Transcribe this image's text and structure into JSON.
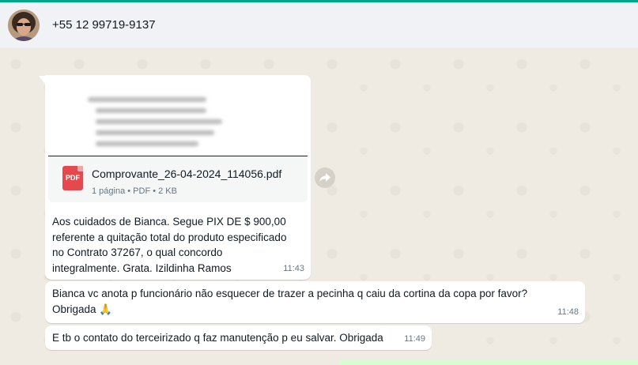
{
  "header": {
    "contact": "+55 12 99719-9137"
  },
  "messages": [
    {
      "document": {
        "filename": "Comprovante_26-04-2024_114056.pdf",
        "meta": "1 página • PDF • 2 KB",
        "icon_text": "PDF"
      },
      "caption_lines": [
        "Aos cuidados de Bianca. Segue PIX DE $ 900,00",
        "referente a quitação total do produto especificado",
        "no Contrato 37267, o qual concordo",
        "integralmente. Grata. Izildinha Ramos"
      ],
      "time": "11:43"
    },
    {
      "lines": [
        "Bianca vc anota p funcionário não esquecer de trazer a pecinha q caiu da cortina da copa por favor?",
        "Obrigada 🙏"
      ],
      "time": "11:48"
    },
    {
      "text": "E tb o contato do terceirizado q faz manutenção p eu salvar. Obrigada",
      "time": "11:49"
    }
  ],
  "icons": {
    "avatar": "avatar",
    "document": "pdf-icon",
    "forward": "forward-icon"
  },
  "colors": {
    "accent": "#00a884",
    "header_bg": "#f0f2f5",
    "chat_bg": "#efeae2",
    "bubble_in": "#ffffff",
    "pdf_red": "#e5484d"
  }
}
